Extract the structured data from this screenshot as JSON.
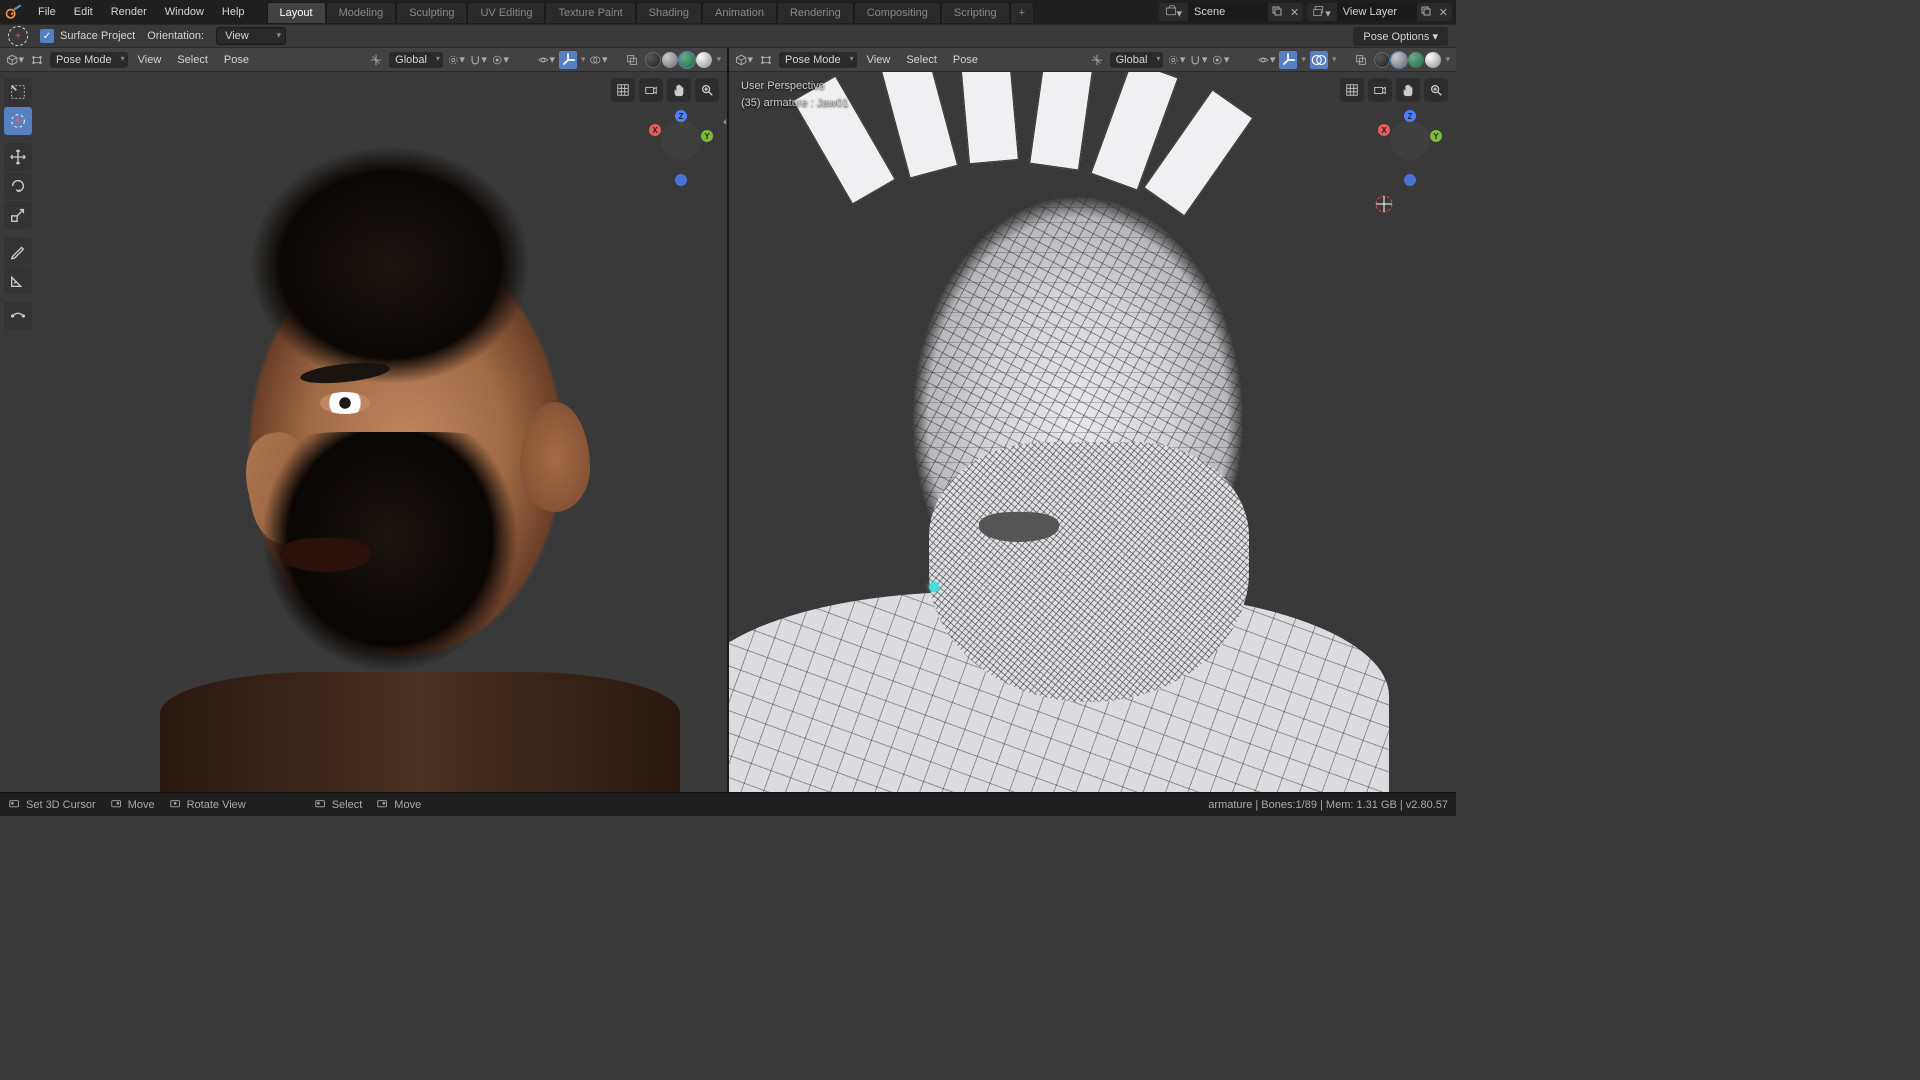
{
  "menu": {
    "file": "File",
    "edit": "Edit",
    "render": "Render",
    "window": "Window",
    "help": "Help"
  },
  "workspaces": {
    "layout": "Layout",
    "modeling": "Modeling",
    "sculpting": "Sculpting",
    "uv": "UV Editing",
    "texture": "Texture Paint",
    "shading": "Shading",
    "animation": "Animation",
    "rendering": "Rendering",
    "compositing": "Compositing",
    "scripting": "Scripting",
    "add": "+"
  },
  "header": {
    "scene_label": "Scene",
    "viewlayer_label": "View Layer"
  },
  "toolheader": {
    "surface_project": "Surface Project",
    "orientation": "Orientation:",
    "orientation_value": "View",
    "pose_options": "Pose Options"
  },
  "vp": {
    "mode": "Pose Mode",
    "view": "View",
    "select": "Select",
    "pose": "Pose",
    "global": "Global"
  },
  "overlay": {
    "perspective": "User Perspective",
    "object": "(35) armature : Jaw01"
  },
  "status": {
    "cursor": "Set 3D Cursor",
    "move1": "Move",
    "rotate": "Rotate View",
    "select": "Select",
    "move2": "Move",
    "right": "armature | Bones:1/89 | Mem: 1.31 GB | v2.80.57"
  },
  "axis": {
    "x": "X",
    "y": "Y",
    "z": "Z"
  }
}
